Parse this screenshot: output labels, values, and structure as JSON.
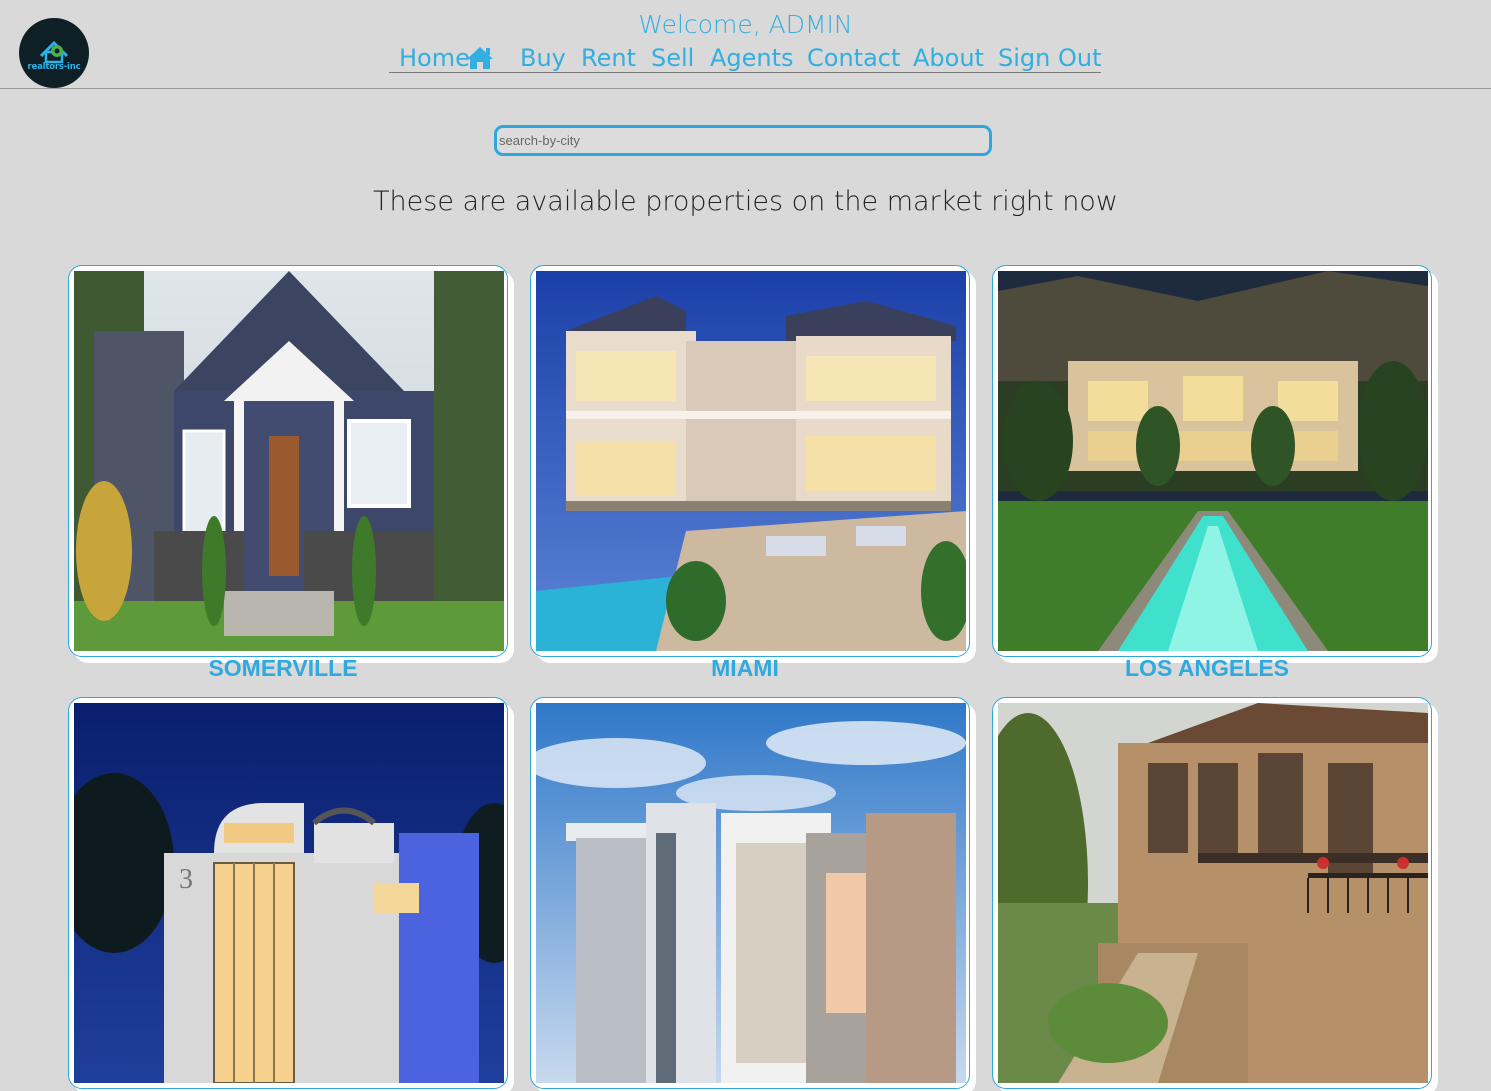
{
  "header": {
    "logo_text": "realtors-inc",
    "welcome": "Welcome, ADMIN",
    "nav": [
      {
        "label": "Home"
      },
      {
        "label": "Buy"
      },
      {
        "label": "Rent"
      },
      {
        "label": "Sell"
      },
      {
        "label": "Agents"
      },
      {
        "label": "Contact"
      },
      {
        "label": "About"
      },
      {
        "label": "Sign Out"
      }
    ]
  },
  "search": {
    "placeholder": "search-by-city",
    "value": ""
  },
  "main": {
    "tagline": "These are available properties on the market right now",
    "cards": [
      {
        "city": "SOMERVILLE"
      },
      {
        "city": "MIAMI"
      },
      {
        "city": "LOS ANGELES"
      },
      {
        "city": ""
      },
      {
        "city": ""
      },
      {
        "city": ""
      }
    ]
  },
  "colors": {
    "accent": "#33aee0",
    "background": "#d9d9d9",
    "card": "#ffffff"
  }
}
